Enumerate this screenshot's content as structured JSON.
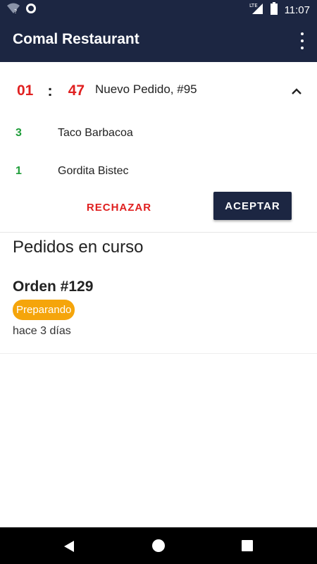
{
  "status_bar": {
    "time": "11:07",
    "network": "LTE"
  },
  "app_bar": {
    "title": "Comal Restaurant"
  },
  "new_order": {
    "timer_minutes": "01",
    "timer_separator": ":",
    "timer_seconds": "47",
    "title": "Nuevo Pedido, #95",
    "items": [
      {
        "qty": "3",
        "name": "Taco Barbacoa"
      },
      {
        "qty": "1",
        "name": "Gordita Bistec"
      }
    ],
    "reject_label": "RECHAZAR",
    "accept_label": "ACEPTAR"
  },
  "in_progress": {
    "section_title": "Pedidos en curso",
    "orders": [
      {
        "number": "Orden #129",
        "status": "Preparando",
        "time": "hace 3 días"
      }
    ]
  },
  "colors": {
    "primary": "#1c2642",
    "timer": "#e02020",
    "quantity": "#1f9d3a",
    "status_preparing": "#f5a50b"
  }
}
